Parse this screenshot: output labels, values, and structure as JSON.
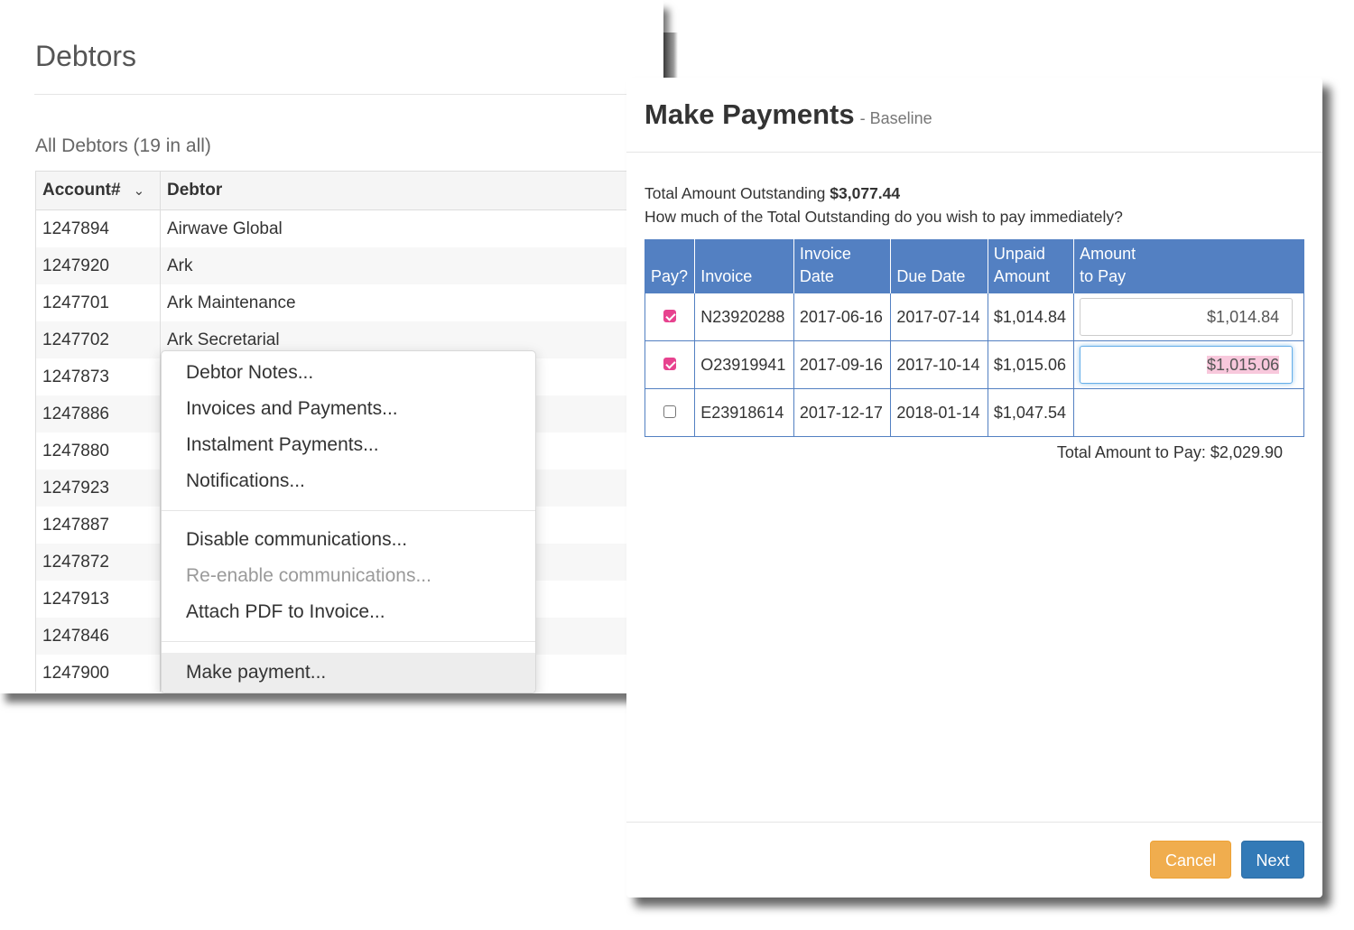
{
  "debtors": {
    "title": "Debtors",
    "subtitle": "All Debtors (19 in all)",
    "columns": {
      "account": "Account#",
      "debtor": "Debtor",
      "sort_caret": "⌄"
    },
    "rows": [
      {
        "account": "1247894",
        "name": "Airwave Global"
      },
      {
        "account": "1247920",
        "name": "Ark"
      },
      {
        "account": "1247701",
        "name": "Ark Maintenance"
      },
      {
        "account": "1247702",
        "name": "Ark Secretarial"
      },
      {
        "account": "1247873",
        "name": ""
      },
      {
        "account": "1247886",
        "name": ""
      },
      {
        "account": "1247880",
        "name": ""
      },
      {
        "account": "1247923",
        "name": ""
      },
      {
        "account": "1247887",
        "name": ""
      },
      {
        "account": "1247872",
        "name": ""
      },
      {
        "account": "1247913",
        "name": ""
      },
      {
        "account": "1247846",
        "name": ""
      },
      {
        "account": "1247900",
        "name": ""
      }
    ]
  },
  "context_menu": {
    "group1": [
      "Debtor Notes...",
      "Invoices and Payments...",
      "Instalment Payments...",
      "Notifications..."
    ],
    "group2": [
      "Disable communications...",
      "Re-enable communications...",
      "Attach PDF to Invoice..."
    ],
    "group3": [
      "Make payment..."
    ]
  },
  "modal": {
    "title": "Make Payments",
    "subtitle": "- Baseline",
    "outstanding_label": "Total Amount Outstanding",
    "outstanding_value": "$3,077.44",
    "question": "How much of the Total Outstanding do you wish to pay immediately?",
    "headers": {
      "pay": "Pay?",
      "invoice": "Invoice",
      "invoice_date": "Invoice Date",
      "due_date": "Due Date",
      "unpaid_1": "Unpaid",
      "unpaid_2": "Amount",
      "amount_1": "Amount",
      "amount_2": "to Pay"
    },
    "invoices": [
      {
        "checked": true,
        "invoice": "N23920288",
        "invoice_date": "2017-06-16",
        "due_date": "2017-07-14",
        "unpaid": "$1,014.84",
        "to_pay": "$1,014.84"
      },
      {
        "checked": true,
        "invoice": "O23919941",
        "invoice_date": "2017-09-16",
        "due_date": "2017-10-14",
        "unpaid": "$1,015.06",
        "to_pay": "$1,015.06"
      },
      {
        "checked": false,
        "invoice": "E23918614",
        "invoice_date": "2017-12-17",
        "due_date": "2018-01-14",
        "unpaid": "$1,047.54",
        "to_pay": ""
      }
    ],
    "total_to_pay": "Total Amount to Pay: $2,029.90",
    "cancel_label": "Cancel",
    "next_label": "Next"
  },
  "colors": {
    "table_header": "#5380c2",
    "checkbox": "#e7438f",
    "cancel": "#f0ad4e",
    "next": "#337ab7"
  }
}
